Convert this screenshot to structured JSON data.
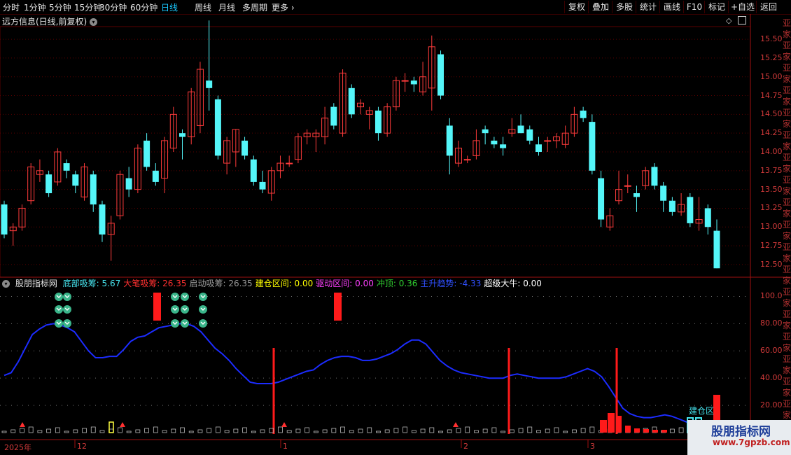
{
  "toolbar": {
    "tabs": [
      "分时",
      "1分钟",
      "5分钟",
      "15分钟",
      "30分钟",
      "60分钟",
      "日线",
      "周线",
      "月线",
      "多周期",
      "更多"
    ],
    "active": "日线",
    "right": [
      "复权",
      "叠加",
      "多股",
      "统计",
      "画线",
      "F10",
      "标记",
      "+自选",
      "返回"
    ]
  },
  "stock": {
    "title": "远方信息(日线,前复权)"
  },
  "price_axis": [
    "15.50",
    "15.25",
    "15.00",
    "14.75",
    "14.50",
    "14.25",
    "14.00",
    "13.75",
    "13.50",
    "13.25",
    "13.00",
    "12.75",
    "12.50"
  ],
  "indicator": {
    "name": "股朋指标网",
    "items": [
      {
        "label": "底部吸筹: 5.67",
        "color": "#47e5ef"
      },
      {
        "label": "大笔吸筹: 26.35",
        "color": "#ff3030"
      },
      {
        "label": "启动吸筹: 26.35",
        "color": "#9a9a9a"
      },
      {
        "label": "建仓区间: 0.00",
        "color": "#ffff00"
      },
      {
        "label": "驱动区间: 0.00",
        "color": "#ff40ff"
      },
      {
        "label": "冲顶: 0.36",
        "color": "#30d030"
      },
      {
        "label": "主升趋势: -4.33",
        "color": "#3050ff"
      },
      {
        "label": "超级大牛: 0.00",
        "color": "#ffffff"
      }
    ],
    "axis": [
      "100.0",
      "80.00",
      "60.00",
      "40.00",
      "20.00"
    ],
    "tag": "建仓区"
  },
  "dates": [
    "2025年",
    "12",
    "1",
    "2",
    "3"
  ],
  "side_chars": [
    "亚",
    "家",
    "亚",
    "家",
    "亚",
    "家",
    "亚",
    "家",
    "亚",
    "家",
    "亚",
    "家",
    "亚",
    "家",
    "亚",
    "家",
    "亚",
    "家",
    "亚",
    "家",
    "亚",
    "家",
    "亚",
    "家",
    "亚",
    "家",
    "亚",
    "家",
    "亚",
    "家",
    "亚",
    "家",
    "亚",
    "家",
    "亚",
    "家"
  ],
  "colors": {
    "up": "#ff3b3b",
    "down": "#54f6f9",
    "line": "#1c2cff",
    "grid": "#5a0000"
  },
  "watermark": {
    "title": "股朋指标网",
    "url": "www.7gpzb.com"
  },
  "chart_data": [
    {
      "type": "candlestick",
      "title": "远方信息(日线,前复权)",
      "ylim": [
        12.35,
        15.65
      ],
      "ohlc": [
        [
          13.3,
          13.35,
          12.85,
          12.9
        ],
        [
          12.95,
          13.05,
          12.75,
          13.0
        ],
        [
          13.0,
          13.3,
          12.95,
          13.25
        ],
        [
          13.35,
          13.85,
          13.3,
          13.8
        ],
        [
          13.7,
          13.9,
          13.6,
          13.75
        ],
        [
          13.7,
          13.75,
          13.4,
          13.45
        ],
        [
          13.6,
          14.05,
          13.55,
          14.0
        ],
        [
          13.85,
          13.9,
          13.65,
          13.75
        ],
        [
          13.7,
          13.75,
          13.45,
          13.55
        ],
        [
          13.4,
          13.85,
          13.35,
          13.8
        ],
        [
          13.7,
          13.75,
          13.2,
          13.3
        ],
        [
          13.3,
          13.35,
          12.8,
          12.9
        ],
        [
          12.9,
          13.15,
          12.55,
          13.05
        ],
        [
          13.15,
          13.75,
          13.1,
          13.7
        ],
        [
          13.65,
          13.8,
          13.4,
          13.5
        ],
        [
          13.5,
          14.1,
          13.45,
          14.05
        ],
        [
          14.15,
          14.25,
          13.75,
          13.8
        ],
        [
          13.75,
          13.85,
          13.55,
          13.6
        ],
        [
          13.65,
          14.2,
          13.45,
          14.15
        ],
        [
          14.05,
          14.6,
          14.0,
          14.5
        ],
        [
          14.25,
          14.3,
          13.9,
          14.2
        ],
        [
          14.2,
          14.85,
          14.1,
          14.8
        ],
        [
          14.35,
          15.2,
          14.25,
          15.1
        ],
        [
          14.95,
          15.75,
          14.55,
          14.85
        ],
        [
          14.7,
          14.75,
          13.9,
          13.95
        ],
        [
          13.85,
          14.2,
          13.7,
          14.15
        ],
        [
          14.0,
          14.3,
          13.8,
          14.3
        ],
        [
          14.15,
          14.2,
          13.9,
          13.95
        ],
        [
          13.9,
          13.95,
          13.55,
          13.6
        ],
        [
          13.6,
          13.75,
          13.45,
          13.5
        ],
        [
          13.45,
          13.8,
          13.35,
          13.75
        ],
        [
          13.75,
          13.95,
          13.65,
          13.85
        ],
        [
          13.85,
          13.95,
          13.8,
          13.85
        ],
        [
          13.9,
          14.25,
          13.85,
          14.2
        ],
        [
          14.2,
          14.3,
          14.1,
          14.25
        ],
        [
          14.2,
          14.3,
          14.0,
          14.25
        ],
        [
          14.2,
          14.6,
          14.1,
          14.45
        ],
        [
          14.6,
          14.65,
          14.3,
          14.35
        ],
        [
          14.25,
          15.1,
          14.2,
          15.05
        ],
        [
          14.85,
          14.9,
          14.45,
          14.5
        ],
        [
          14.6,
          14.7,
          14.5,
          14.65
        ],
        [
          14.5,
          14.6,
          14.3,
          14.55
        ],
        [
          14.55,
          14.6,
          14.15,
          14.25
        ],
        [
          14.25,
          14.65,
          14.2,
          14.6
        ],
        [
          14.6,
          15.0,
          14.55,
          14.95
        ],
        [
          14.95,
          15.05,
          14.8,
          14.95
        ],
        [
          14.95,
          15.0,
          14.8,
          14.9
        ],
        [
          14.8,
          15.2,
          14.75,
          15.0
        ],
        [
          14.85,
          15.55,
          14.55,
          15.4
        ],
        [
          15.3,
          15.35,
          14.7,
          14.75
        ],
        [
          14.35,
          14.45,
          13.7,
          13.95
        ],
        [
          13.85,
          14.15,
          13.8,
          14.05
        ],
        [
          13.9,
          13.95,
          13.85,
          13.9
        ],
        [
          13.95,
          14.3,
          13.9,
          14.15
        ],
        [
          14.3,
          14.35,
          14.1,
          14.25
        ],
        [
          14.15,
          14.2,
          14.05,
          14.1
        ],
        [
          14.1,
          14.2,
          13.95,
          14.05
        ],
        [
          14.25,
          14.45,
          14.2,
          14.3
        ],
        [
          14.35,
          14.5,
          14.25,
          14.25
        ],
        [
          14.3,
          14.35,
          14.1,
          14.15
        ],
        [
          14.1,
          14.2,
          13.95,
          14.0
        ],
        [
          14.15,
          14.2,
          14.0,
          14.15
        ],
        [
          14.15,
          14.25,
          14.05,
          14.2
        ],
        [
          14.1,
          14.35,
          14.05,
          14.25
        ],
        [
          14.25,
          14.6,
          14.2,
          14.5
        ],
        [
          14.55,
          14.6,
          14.4,
          14.45
        ],
        [
          14.4,
          14.5,
          13.7,
          13.75
        ],
        [
          13.65,
          13.75,
          13.0,
          13.1
        ],
        [
          13.0,
          13.25,
          12.95,
          13.15
        ],
        [
          13.35,
          13.75,
          13.3,
          13.5
        ],
        [
          13.55,
          13.7,
          13.45,
          13.55
        ],
        [
          13.45,
          13.55,
          13.2,
          13.4
        ],
        [
          13.55,
          13.8,
          13.5,
          13.75
        ],
        [
          13.8,
          13.85,
          13.5,
          13.55
        ],
        [
          13.55,
          13.6,
          13.2,
          13.35
        ],
        [
          13.35,
          13.4,
          13.15,
          13.2
        ],
        [
          13.2,
          13.45,
          13.15,
          13.3
        ],
        [
          13.4,
          13.45,
          13.0,
          13.05
        ],
        [
          13.05,
          13.4,
          12.95,
          13.1
        ],
        [
          13.25,
          13.3,
          12.9,
          13.0
        ],
        [
          12.95,
          13.1,
          12.45,
          12.45
        ]
      ]
    },
    {
      "type": "line",
      "title": "股朋指标网",
      "ylim": [
        0,
        110
      ],
      "series": [
        {
          "name": "主升趋势",
          "values": [
            42,
            44,
            52,
            62,
            72,
            76,
            79,
            80,
            79,
            77,
            74,
            67,
            60,
            55,
            55,
            56,
            56,
            61,
            67,
            70,
            71,
            74,
            77,
            78,
            79,
            80,
            80,
            78,
            74,
            68,
            62,
            58,
            53,
            47,
            42,
            37,
            36,
            36,
            36,
            37,
            39,
            41,
            43,
            45,
            46,
            50,
            53,
            55,
            56,
            56,
            55,
            53,
            53,
            54,
            56,
            58,
            61,
            65,
            68,
            68,
            65,
            59,
            53,
            49,
            46,
            44,
            43,
            42,
            41,
            40,
            40,
            40,
            42,
            43,
            42,
            41,
            40,
            40,
            40,
            40,
            41,
            43,
            45,
            47,
            45,
            41,
            34,
            26,
            18,
            14,
            12,
            11,
            11,
            12,
            13,
            12,
            10,
            8,
            6,
            3,
            0,
            -4
          ]
        }
      ]
    }
  ]
}
